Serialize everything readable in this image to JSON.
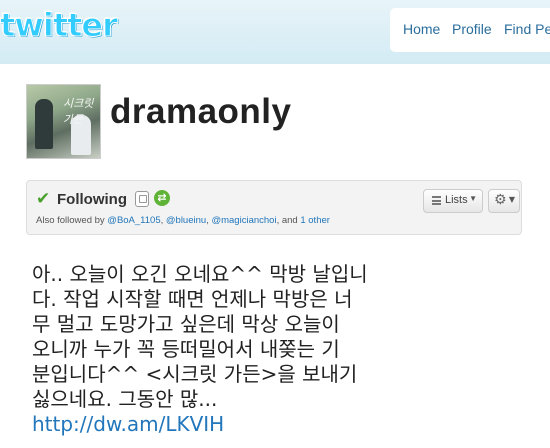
{
  "header": {
    "logo_text": "twitter",
    "nav": [
      "Home",
      "Profile",
      "Find Pe"
    ]
  },
  "profile": {
    "username": "dramaonly",
    "avatar_text": "시크릿가든"
  },
  "follow_box": {
    "following_label": "Following",
    "also_prefix": "Also followed by ",
    "also_users": [
      "@BoA_1105",
      "@blueinu",
      "@magicianchoi"
    ],
    "also_and": ", and ",
    "also_other": "1 other",
    "lists_label": "Lists"
  },
  "tweet": {
    "lines": [
      "아.. 오늘이 오긴 오네요^^ 막방 날입니",
      "다. 작업 시작할 때면 언제나 막방은 너",
      "무 멀고 도망가고 싶은데 막상 오늘이",
      "오니까 누가 꼭 등떠밀어서 내쫒는 기",
      "분입니다^^ <시크릿 가든>을 보내기",
      "싫으네요. 그동안 많..."
    ],
    "link": "http://dw.am/LKVIH"
  },
  "colors": {
    "topbar": "#d3ebf4",
    "logo": "#33ccff",
    "link": "#2276bb",
    "check": "#4aa02c"
  }
}
